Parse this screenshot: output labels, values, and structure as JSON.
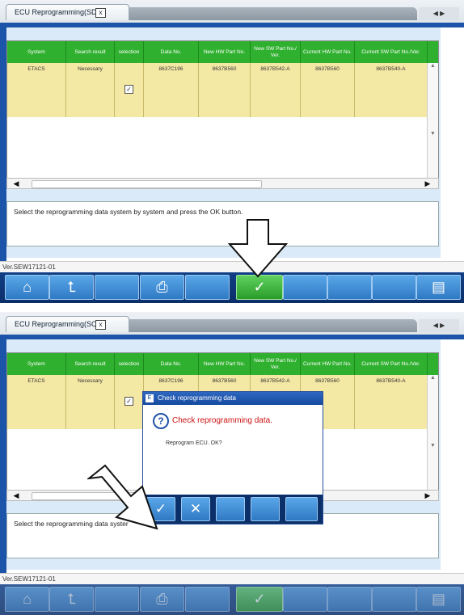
{
  "screen_top": {
    "tab": {
      "label": "ECU Reprogramming(SDB)",
      "close": "x"
    },
    "nav_arrows": "◀ ▶",
    "table": {
      "headers": [
        "System",
        "Search result",
        "selection",
        "Data No.",
        "New HW Part No.",
        "New SW Part No./ Ver.",
        "Current HW Part No.",
        "Current SW Part No./Ver."
      ],
      "row": [
        "ETACS",
        "Necessary",
        "",
        "8637C196",
        "8637B560",
        "8637B542-A",
        "8637B560",
        "8637B540-A"
      ],
      "checkbox": "✓"
    },
    "message": "Select the reprogramming data system by system and press the OK button.",
    "version": "Ver.SEW17121-01",
    "toolbar": {
      "home_icon": "home-icon",
      "back_icon": "return-arrow-icon",
      "printer_icon": "printer-icon",
      "ok_label": "✓",
      "list_icon": "list-icon"
    }
  },
  "screen_bottom": {
    "tab": {
      "label": "ECU Reprogramming(SOB)",
      "close": "x"
    },
    "nav_arrows": "◀ ▶",
    "table": {
      "headers": [
        "System",
        "Search result",
        "selection",
        "Data No.",
        "New HW Part No.",
        "New SW Part No./ Ver.",
        "Current HW Part No.",
        "Current SW Part No./Ver."
      ],
      "row": [
        "ETACS",
        "Necessary",
        "",
        "8637C196",
        "8637B560",
        "8637B542-A",
        "8637B560",
        "8637B540-A"
      ],
      "checkbox": "✓"
    },
    "message": "Select the reprogramming data syster",
    "version": "Ver.SEW17121-01",
    "dialog": {
      "title": "Check reprogramming data",
      "heading": "Check reprogramming data.",
      "body": "Reprogram ECU. OK?",
      "ok_label": "✓",
      "cancel_label": "✕"
    },
    "toolbar": {
      "ok_label": "✓"
    }
  },
  "colors": {
    "header_green": "#2fb02f",
    "row_yellow": "#f3e8a4",
    "toolbar_blue": "#0b2f68",
    "accent_blue": "#1b54a8"
  }
}
